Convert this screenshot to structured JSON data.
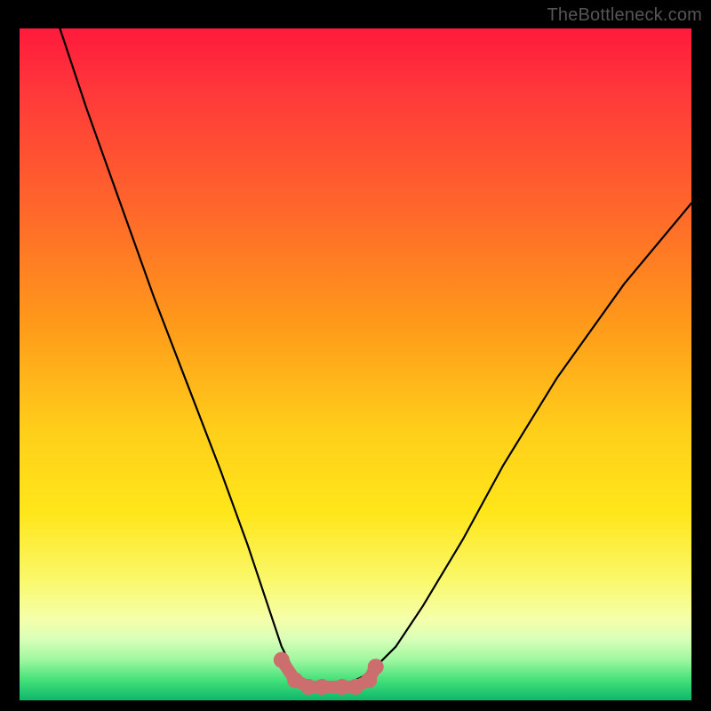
{
  "watermark": "TheBottleneck.com",
  "colors": {
    "frame": "#000000",
    "curve_stroke": "#000000",
    "marker_stroke": "#cc6e6e",
    "marker_fill": "#cc6e6e",
    "gradient_stops": [
      "#ff1a3c",
      "#ff3a3a",
      "#ff6a2a",
      "#ff9a1a",
      "#ffcf1a",
      "#ffe61a",
      "#faf86a",
      "#f5ffab",
      "#d7ffb8",
      "#9ef7a0",
      "#44e07a",
      "#0db86b"
    ]
  },
  "chart_data": {
    "type": "line",
    "title": "",
    "xlabel": "",
    "ylabel": "",
    "xlim": [
      0,
      100
    ],
    "ylim": [
      0,
      100
    ],
    "grid": false,
    "legend": false,
    "series": [
      {
        "name": "bottleneck-curve",
        "x": [
          6,
          10,
          15,
          20,
          25,
          30,
          34,
          37,
          39,
          41,
          43,
          45,
          48,
          52,
          56,
          60,
          66,
          72,
          80,
          90,
          100
        ],
        "y": [
          100,
          88,
          74,
          60,
          47,
          34,
          23,
          14,
          8,
          4,
          2,
          2,
          2,
          4,
          8,
          14,
          24,
          35,
          48,
          62,
          74
        ]
      }
    ],
    "markers": {
      "name": "trough-markers",
      "x": [
        39,
        41,
        43,
        45,
        48,
        50,
        52,
        53
      ],
      "y": [
        6,
        3,
        2,
        2,
        2,
        2,
        3,
        5
      ]
    },
    "annotations": []
  }
}
